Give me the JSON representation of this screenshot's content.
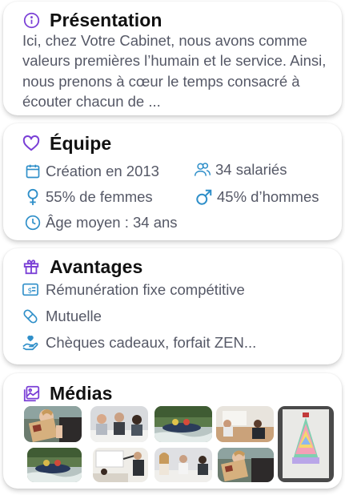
{
  "presentation": {
    "title": "Présentation",
    "text": "Ici, chez Votre Cabinet, nous avons comme valeurs premières l’humain et le service. Ainsi, nous prenons à cœur le temps consacré à écouter chacun de ...",
    "icon": "info-icon"
  },
  "equipe": {
    "title": "Équipe",
    "icon": "heart-icon",
    "facts": {
      "creation": "Création en 2013",
      "salaries": "34 salariés",
      "femmes": "55% de femmes",
      "hommes": "45% d’hommes",
      "age": "Âge moyen : 34 ans"
    }
  },
  "avantages": {
    "title": "Avantages",
    "icon": "gift-icon",
    "items": [
      "Rémunération fixe compétitive",
      "Mutuelle",
      "Chèques cadeaux, forfait ZEN..."
    ]
  },
  "medias": {
    "title": "Médias",
    "icon": "images-icon",
    "thumbnails": [
      "book-reading-photo",
      "office-meeting-photo",
      "river-rafting-photo",
      "meeting-room-photo",
      "post-it-tree-photo",
      "rafting-photo",
      "presentation-photo",
      "team-meeting-photo",
      "book-reading-photo"
    ]
  },
  "colors": {
    "accent_purple": "#7a3fd6",
    "accent_blue": "#2f8fc9",
    "text_gray": "#555866"
  }
}
